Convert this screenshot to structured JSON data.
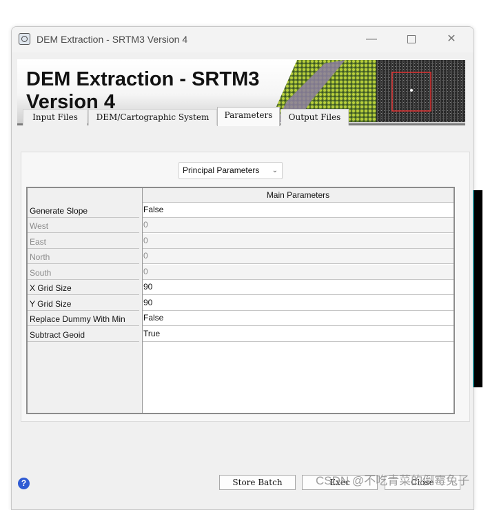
{
  "window": {
    "title": "DEM Extraction - SRTM3 Version 4",
    "controls": {
      "minimize": "—",
      "close": "✕"
    }
  },
  "banner": {
    "title": "DEM Extraction - SRTM3\nVersion 4"
  },
  "tabs": [
    {
      "label": "Input Files",
      "active": false
    },
    {
      "label": "DEM/Cartographic System",
      "active": false
    },
    {
      "label": "Parameters",
      "active": true
    },
    {
      "label": "Output Files",
      "active": false
    }
  ],
  "parameters": {
    "selector_value": "Principal Parameters",
    "grid_header": "Main Parameters",
    "rows": [
      {
        "name": "Generate Slope",
        "value": "False",
        "enabled": true
      },
      {
        "name": "West",
        "value": "0",
        "enabled": false
      },
      {
        "name": "East",
        "value": "0",
        "enabled": false
      },
      {
        "name": "North",
        "value": "0",
        "enabled": false
      },
      {
        "name": "South",
        "value": "0",
        "enabled": false
      },
      {
        "name": "X Grid Size",
        "value": "90",
        "enabled": true
      },
      {
        "name": "Y Grid Size",
        "value": "90",
        "enabled": true
      },
      {
        "name": "Replace Dummy With Min",
        "value": "False",
        "enabled": true
      },
      {
        "name": "Subtract Geoid",
        "value": "True",
        "enabled": true
      }
    ]
  },
  "footer": {
    "help": "?",
    "store_batch": "Store Batch",
    "exec": "Exec",
    "close": "Close"
  },
  "watermark": "CSDN @不吃青菜的倒霉兔子"
}
